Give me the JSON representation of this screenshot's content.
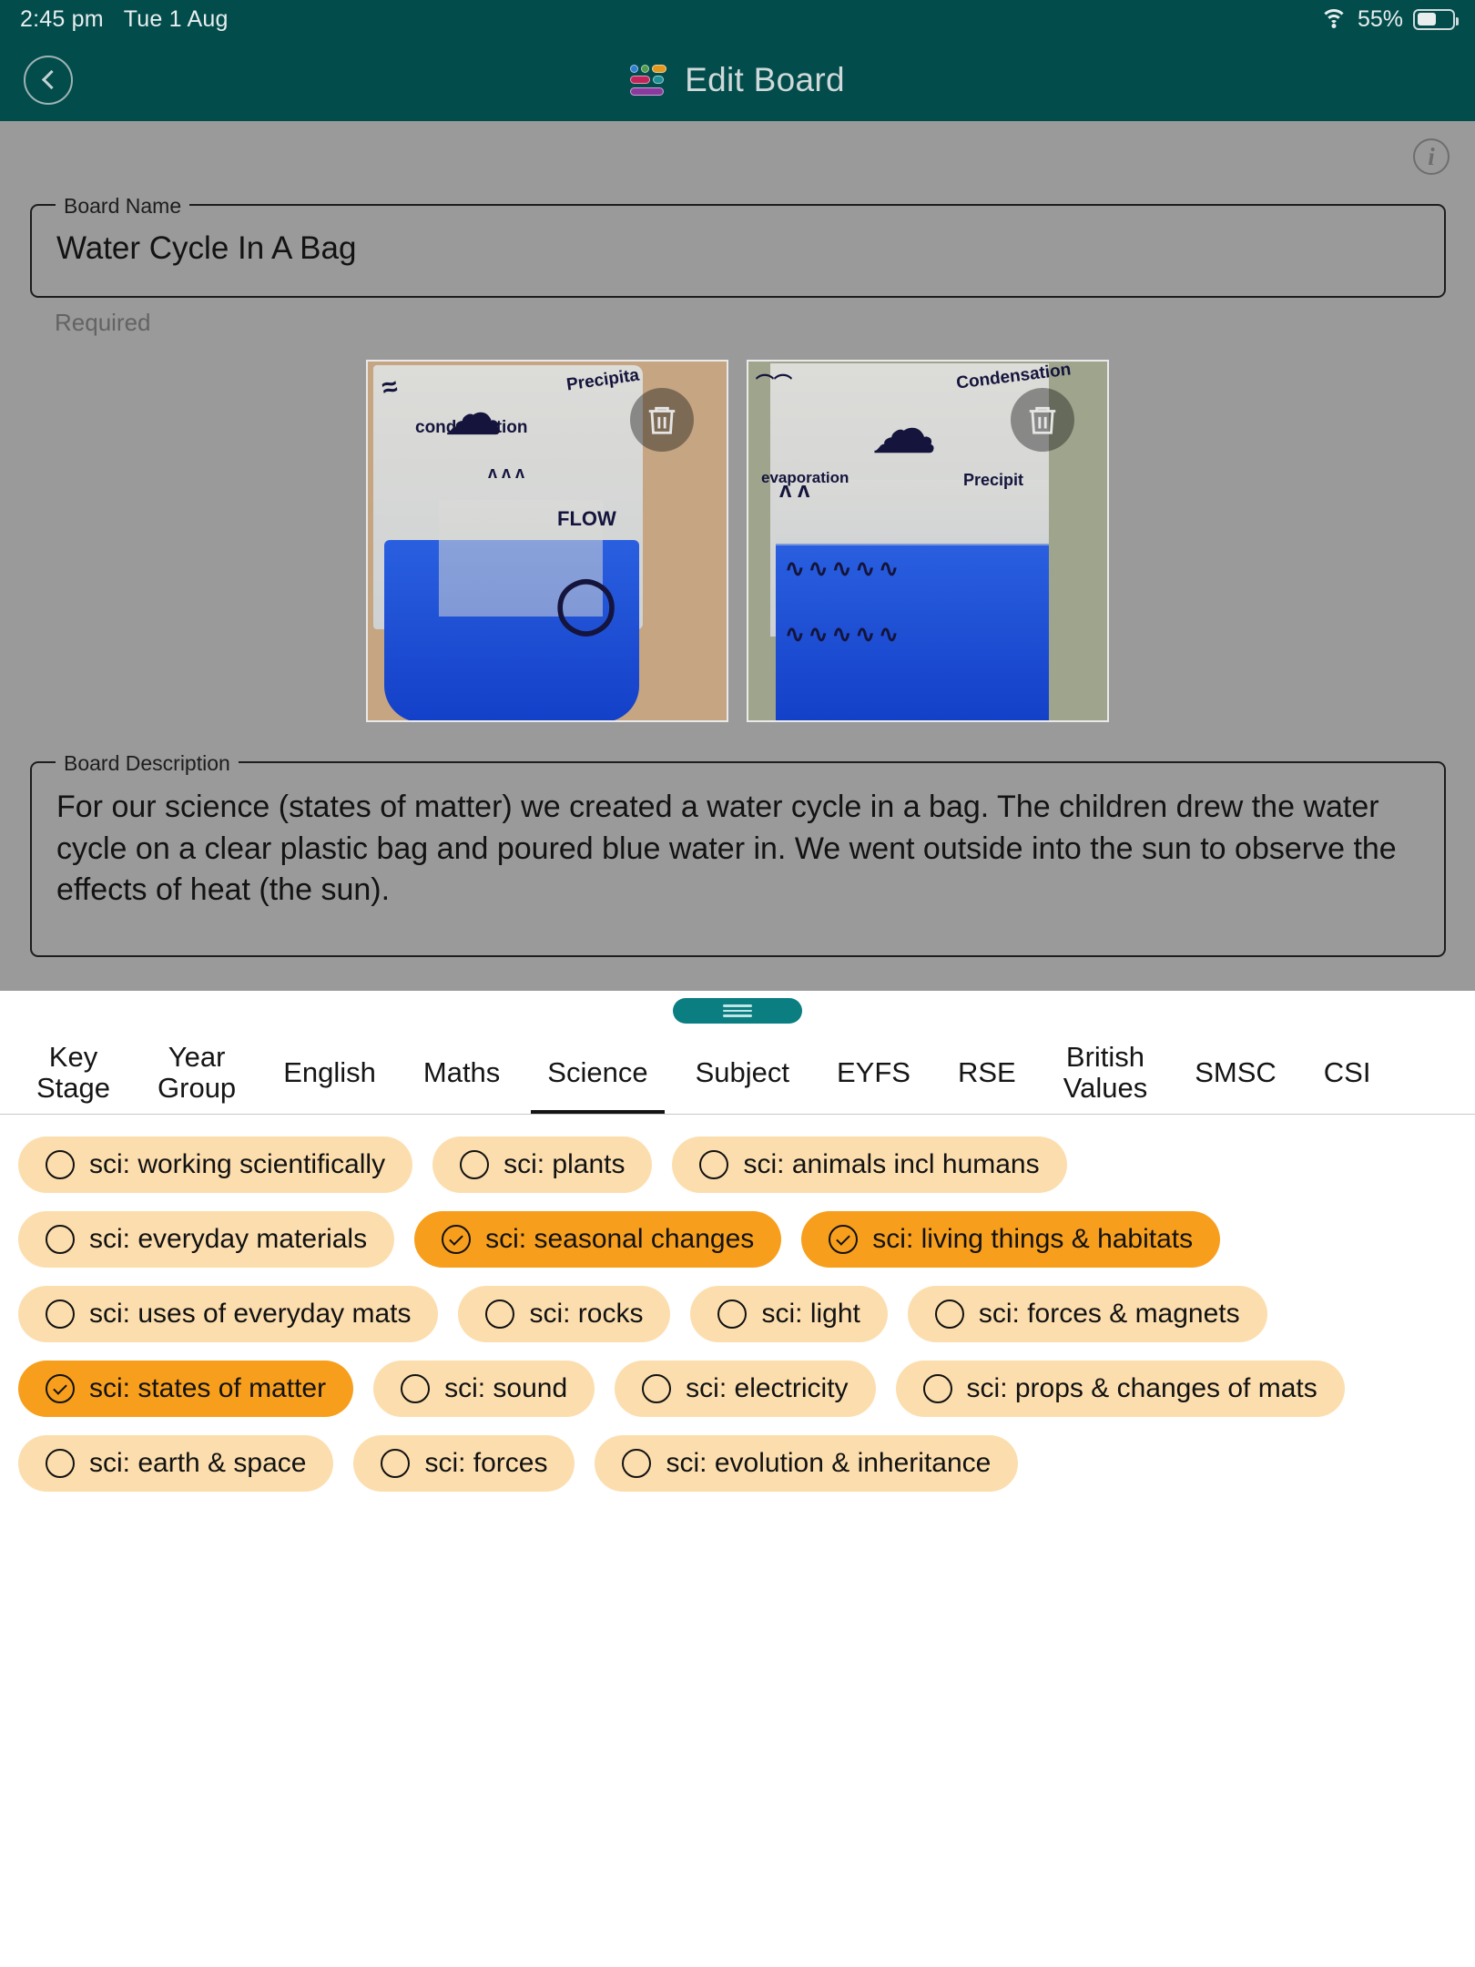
{
  "status_bar": {
    "time": "2:45 pm",
    "date": "Tue 1 Aug",
    "battery_percent": "55%",
    "wifi_icon": "wifi-icon",
    "battery_icon": "battery-icon"
  },
  "nav": {
    "back_icon": "back-chevron-icon",
    "logo_icon": "app-logo-icon",
    "title": "Edit Board",
    "bar_color": "#034c4c"
  },
  "content": {
    "info_icon": "info-icon",
    "background_color": "#9a9a9a",
    "board_name": {
      "legend": "Board Name",
      "value": "Water Cycle In A Bag",
      "helper": "Required"
    },
    "board_description": {
      "legend": "Board Description",
      "value": "For our science (states of matter) we created a water cycle in a bag. The children drew the water cycle on a clear plastic bag and poured blue water in. We went outside into the sun to observe the effects of heat (the sun)."
    },
    "photos": [
      {
        "alt": "water cycle in a bag photo 1",
        "delete_icon": "trash-icon",
        "ink_labels": [
          "Precipitation",
          "condensation",
          "FLOW"
        ]
      },
      {
        "alt": "water cycle in a bag photo 2",
        "delete_icon": "trash-icon",
        "ink_labels": [
          "Condensation",
          "evaporation",
          "Precipitation"
        ]
      }
    ]
  },
  "sheet": {
    "drag_handle_icon": "drag-handle-icon",
    "drag_handle_color": "#0b7e81",
    "tabs": [
      {
        "label": "Key\nStage",
        "active": false
      },
      {
        "label": "Year\nGroup",
        "active": false
      },
      {
        "label": "English",
        "active": false
      },
      {
        "label": "Maths",
        "active": false
      },
      {
        "label": "Science",
        "active": true
      },
      {
        "label": "Subject",
        "active": false
      },
      {
        "label": "EYFS",
        "active": false
      },
      {
        "label": "RSE",
        "active": false
      },
      {
        "label": "British\nValues",
        "active": false
      },
      {
        "label": "SMSC",
        "active": false
      },
      {
        "label": "CSI",
        "active": false
      }
    ],
    "chip_colors": {
      "unselected": "#fcdeae",
      "selected": "#f79f1d"
    },
    "chips": [
      {
        "label": "sci: working scientifically",
        "selected": false
      },
      {
        "label": "sci: plants",
        "selected": false
      },
      {
        "label": "sci: animals incl humans",
        "selected": false
      },
      {
        "label": "sci: everyday materials",
        "selected": false
      },
      {
        "label": "sci: seasonal changes",
        "selected": true
      },
      {
        "label": "sci: living things & habitats",
        "selected": true
      },
      {
        "label": "sci: uses of everyday mats",
        "selected": false
      },
      {
        "label": "sci: rocks",
        "selected": false
      },
      {
        "label": "sci: light",
        "selected": false
      },
      {
        "label": "sci: forces & magnets",
        "selected": false
      },
      {
        "label": "sci: states of matter",
        "selected": true
      },
      {
        "label": "sci: sound",
        "selected": false
      },
      {
        "label": "sci: electricity",
        "selected": false
      },
      {
        "label": "sci: props & changes of mats",
        "selected": false
      },
      {
        "label": "sci: earth & space",
        "selected": false
      },
      {
        "label": "sci: forces",
        "selected": false
      },
      {
        "label": "sci: evolution & inheritance",
        "selected": false
      }
    ]
  }
}
